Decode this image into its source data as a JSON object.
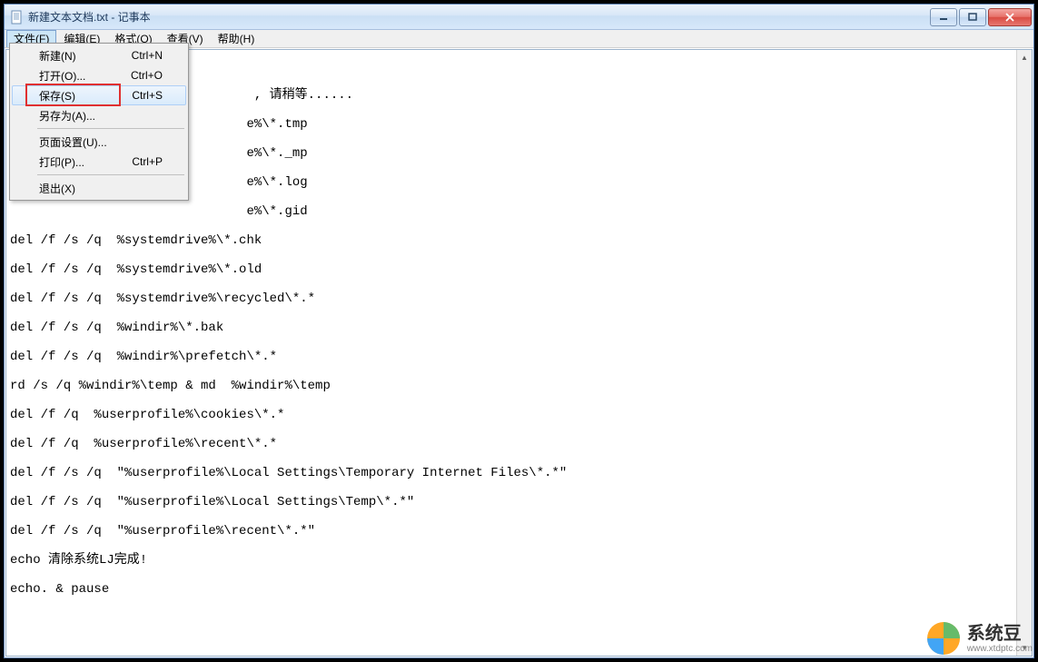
{
  "window": {
    "title": "新建文本文档.txt - 记事本"
  },
  "menubar": {
    "file": "文件(F)",
    "edit": "编辑(E)",
    "format": "格式(O)",
    "view": "查看(V)",
    "help": "帮助(H)"
  },
  "file_menu": {
    "new": {
      "label": "新建(N)",
      "shortcut": "Ctrl+N"
    },
    "open": {
      "label": "打开(O)...",
      "shortcut": "Ctrl+O"
    },
    "save": {
      "label": "保存(S)",
      "shortcut": "Ctrl+S"
    },
    "saveas": {
      "label": "另存为(A)...",
      "shortcut": ""
    },
    "pagesetup": {
      "label": "页面设置(U)...",
      "shortcut": ""
    },
    "print": {
      "label": "打印(P)...",
      "shortcut": "Ctrl+P"
    },
    "exit": {
      "label": "退出(X)",
      "shortcut": ""
    }
  },
  "editor_lines": [
    "",
    "                                , 请稍等......",
    "                               e%\\*.tmp",
    "                               e%\\*._mp",
    "                               e%\\*.log",
    "                               e%\\*.gid",
    "del /f /s /q  %systemdrive%\\*.chk",
    "del /f /s /q  %systemdrive%\\*.old",
    "del /f /s /q  %systemdrive%\\recycled\\*.*",
    "del /f /s /q  %windir%\\*.bak",
    "del /f /s /q  %windir%\\prefetch\\*.*",
    "rd /s /q %windir%\\temp & md  %windir%\\temp",
    "del /f /q  %userprofile%\\cookies\\*.*",
    "del /f /q  %userprofile%\\recent\\*.*",
    "del /f /s /q  \"%userprofile%\\Local Settings\\Temporary Internet Files\\*.*\"",
    "del /f /s /q  \"%userprofile%\\Local Settings\\Temp\\*.*\"",
    "del /f /s /q  \"%userprofile%\\recent\\*.*\"",
    "echo 清除系统LJ完成!",
    "echo. & pause"
  ],
  "watermark": {
    "title": "系统豆",
    "url": "www.xtdptc.com"
  }
}
